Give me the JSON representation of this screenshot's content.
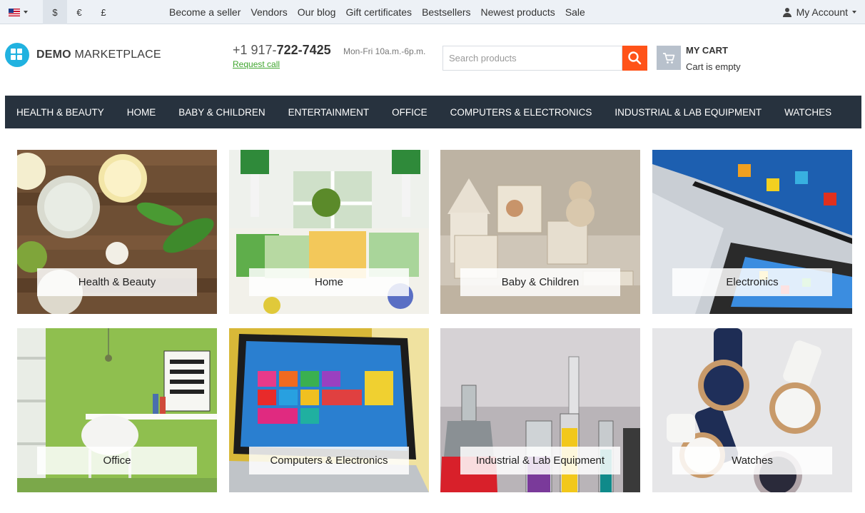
{
  "topbar": {
    "language_flag": "us-flag-icon",
    "currencies": [
      "$",
      "€",
      "£"
    ],
    "active_currency": "$",
    "links": [
      "Become a seller",
      "Vendors",
      "Our blog",
      "Gift certificates",
      "Bestsellers",
      "Newest products",
      "Sale"
    ],
    "account_label": "My Account"
  },
  "header": {
    "logo_bold": "DEMO",
    "logo_light": " MARKETPLACE",
    "phone_prefix": "+1 917-",
    "phone_main": "722-7425",
    "hours": "Mon-Fri 10a.m.-6p.m.",
    "request_call": "Request call",
    "search_placeholder": "Search products",
    "cart_title": "MY CART",
    "cart_status": "Cart is empty"
  },
  "nav": {
    "items": [
      "HEALTH & BEAUTY",
      "HOME",
      "BABY & CHILDREN",
      "ENTERTAINMENT",
      "OFFICE",
      "COMPUTERS & ELECTRONICS",
      "INDUSTRIAL & LAB EQUIPMENT",
      "WATCHES"
    ]
  },
  "categories": [
    {
      "label": "Health & Beauty"
    },
    {
      "label": "Home"
    },
    {
      "label": "Baby & Children"
    },
    {
      "label": "Electronics"
    },
    {
      "label": "Office"
    },
    {
      "label": "Computers & Electronics"
    },
    {
      "label": "Industrial & Lab Equipment"
    },
    {
      "label": "Watches"
    }
  ],
  "colors": {
    "accent": "#ff5319",
    "nav_bg": "#27323e",
    "logo": "#21b2e0",
    "link_green": "#40a62f"
  }
}
